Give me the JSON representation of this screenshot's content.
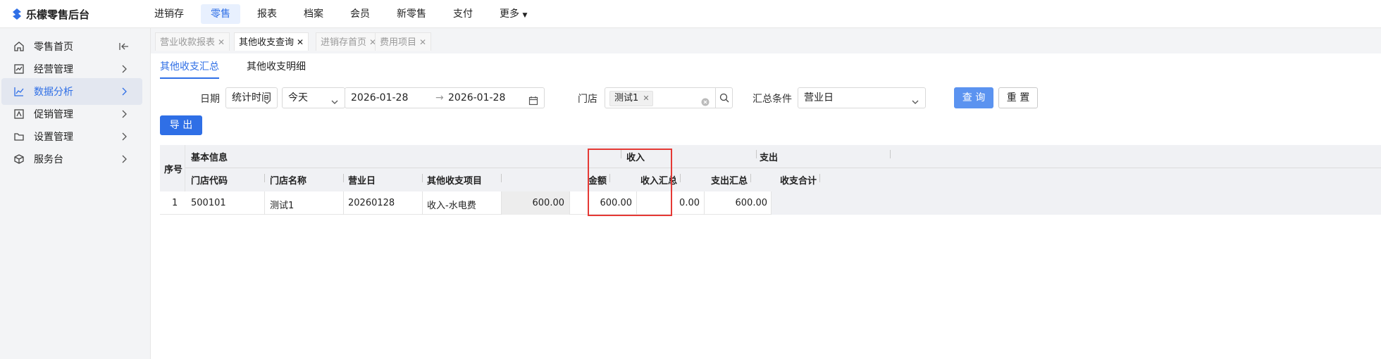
{
  "app": {
    "title": "乐檬零售后台"
  },
  "nav": [
    "进销存",
    "零售",
    "报表",
    "档案",
    "会员",
    "新零售",
    "支付",
    "更多"
  ],
  "sidebar": {
    "items": [
      {
        "label": "零售首页",
        "icon": "home-icon"
      },
      {
        "label": "经营管理",
        "icon": "chart-box-icon"
      },
      {
        "label": "数据分析",
        "icon": "trend-line-icon"
      },
      {
        "label": "促销管理",
        "icon": "promo-tag-icon"
      },
      {
        "label": "设置管理",
        "icon": "folder-icon"
      },
      {
        "label": "服务台",
        "icon": "cube-icon"
      }
    ],
    "collapse_icon": "collapse-left-icon"
  },
  "tabs": [
    "营业收款报表",
    "其他收支查询",
    "进销存首页",
    "费用项目"
  ],
  "subtabs": [
    "其他收支汇总",
    "其他收支明细"
  ],
  "filters": {
    "date_label": "日期",
    "date_type": "统计时间",
    "date_range": "今天",
    "start_date": "2026-01-28",
    "end_date": "2026-01-28",
    "store_label": "门店",
    "store_tag": "测试1",
    "summary_label": "汇总条件",
    "summary_value": "营业日",
    "query_button": "查 询",
    "reset_button": "重 置"
  },
  "export_button": "导 出",
  "table": {
    "groups": {
      "seq": "序号",
      "basic": "基本信息",
      "income": "收入",
      "expense": "支出"
    },
    "columns": [
      "门店代码",
      "门店名称",
      "营业日",
      "其他收支项目",
      "金额",
      "收入汇总",
      "支出汇总",
      "收支合计"
    ],
    "rows": [
      {
        "seq": "1",
        "store_code": "500101",
        "store_name": "测试1",
        "biz_day": "20260128",
        "item": "收入-水电费",
        "amount": "600.00",
        "income_total": "600.00",
        "expense_total": "0.00",
        "net_total": "600.00"
      }
    ]
  },
  "colors": {
    "accent": "#2f6fe6",
    "highlight_box": "#e53935"
  }
}
